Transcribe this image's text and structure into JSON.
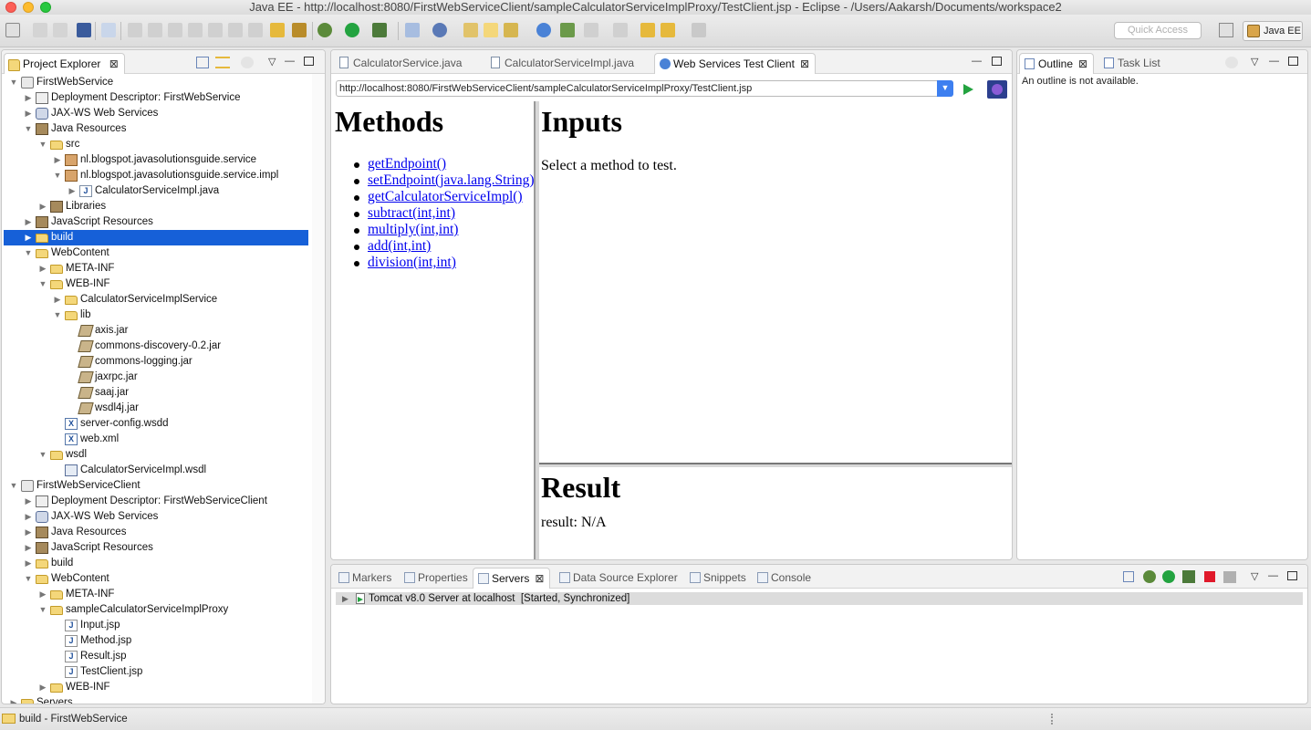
{
  "window": {
    "title": "Java EE - http://localhost:8080/FirstWebServiceClient/sampleCalculatorServiceImplProxy/TestClient.jsp - Eclipse - /Users/Aakarsh/Documents/workspace2"
  },
  "toolbar": {
    "quick_access_placeholder": "Quick Access",
    "perspective_label": "Java EE"
  },
  "project_explorer": {
    "tab_label": "Project Explorer",
    "close_glyph": "⊠",
    "items": [
      {
        "label": "FirstWebService",
        "depth": 0,
        "expanded": true,
        "icon": "project-icon"
      },
      {
        "label": "Deployment Descriptor: FirstWebService",
        "depth": 1,
        "expanded": false,
        "icon": "descriptor-icon"
      },
      {
        "label": "JAX-WS Web Services",
        "depth": 1,
        "expanded": false,
        "icon": "webservice-icon"
      },
      {
        "label": "Java Resources",
        "depth": 1,
        "expanded": true,
        "icon": "java-resources-icon"
      },
      {
        "label": "src",
        "depth": 2,
        "expanded": true,
        "icon": "source-folder-icon"
      },
      {
        "label": "nl.blogspot.javasolutionsguide.service",
        "depth": 3,
        "expanded": false,
        "icon": "package-icon"
      },
      {
        "label": "nl.blogspot.javasolutionsguide.service.impl",
        "depth": 3,
        "expanded": true,
        "icon": "package-icon"
      },
      {
        "label": "CalculatorServiceImpl.java",
        "depth": 4,
        "expanded": false,
        "icon": "java-file-icon"
      },
      {
        "label": "Libraries",
        "depth": 2,
        "expanded": false,
        "icon": "library-icon"
      },
      {
        "label": "JavaScript Resources",
        "depth": 1,
        "expanded": false,
        "icon": "javascript-resources-icon"
      },
      {
        "label": "build",
        "depth": 1,
        "expanded": false,
        "icon": "folder-icon",
        "selected": true
      },
      {
        "label": "WebContent",
        "depth": 1,
        "expanded": true,
        "icon": "folder-icon"
      },
      {
        "label": "META-INF",
        "depth": 2,
        "expanded": false,
        "icon": "folder-icon"
      },
      {
        "label": "WEB-INF",
        "depth": 2,
        "expanded": true,
        "icon": "folder-icon"
      },
      {
        "label": "CalculatorServiceImplService",
        "depth": 3,
        "expanded": false,
        "icon": "folder-icon"
      },
      {
        "label": "lib",
        "depth": 3,
        "expanded": true,
        "icon": "folder-icon"
      },
      {
        "label": "axis.jar",
        "depth": 4,
        "leaf": true,
        "icon": "jar-icon"
      },
      {
        "label": "commons-discovery-0.2.jar",
        "depth": 4,
        "leaf": true,
        "icon": "jar-icon"
      },
      {
        "label": "commons-logging.jar",
        "depth": 4,
        "leaf": true,
        "icon": "jar-icon"
      },
      {
        "label": "jaxrpc.jar",
        "depth": 4,
        "leaf": true,
        "icon": "jar-icon"
      },
      {
        "label": "saaj.jar",
        "depth": 4,
        "leaf": true,
        "icon": "jar-icon"
      },
      {
        "label": "wsdl4j.jar",
        "depth": 4,
        "leaf": true,
        "icon": "jar-icon"
      },
      {
        "label": "server-config.wsdd",
        "depth": 3,
        "leaf": true,
        "icon": "xml-file-icon"
      },
      {
        "label": "web.xml",
        "depth": 3,
        "leaf": true,
        "icon": "xml-file-icon"
      },
      {
        "label": "wsdl",
        "depth": 2,
        "expanded": true,
        "icon": "folder-icon"
      },
      {
        "label": "CalculatorServiceImpl.wsdl",
        "depth": 3,
        "leaf": true,
        "icon": "wsdl-file-icon"
      },
      {
        "label": "FirstWebServiceClient",
        "depth": 0,
        "expanded": true,
        "icon": "project-icon"
      },
      {
        "label": "Deployment Descriptor: FirstWebServiceClient",
        "depth": 1,
        "expanded": false,
        "icon": "descriptor-icon"
      },
      {
        "label": "JAX-WS Web Services",
        "depth": 1,
        "expanded": false,
        "icon": "webservice-icon"
      },
      {
        "label": "Java Resources",
        "depth": 1,
        "expanded": false,
        "icon": "java-resources-icon"
      },
      {
        "label": "JavaScript Resources",
        "depth": 1,
        "expanded": false,
        "icon": "javascript-resources-icon"
      },
      {
        "label": "build",
        "depth": 1,
        "expanded": false,
        "icon": "folder-icon"
      },
      {
        "label": "WebContent",
        "depth": 1,
        "expanded": true,
        "icon": "folder-icon"
      },
      {
        "label": "META-INF",
        "depth": 2,
        "expanded": false,
        "icon": "folder-icon"
      },
      {
        "label": "sampleCalculatorServiceImplProxy",
        "depth": 2,
        "expanded": true,
        "icon": "folder-icon"
      },
      {
        "label": "Input.jsp",
        "depth": 3,
        "leaf": true,
        "icon": "jsp-file-icon"
      },
      {
        "label": "Method.jsp",
        "depth": 3,
        "leaf": true,
        "icon": "jsp-file-icon"
      },
      {
        "label": "Result.jsp",
        "depth": 3,
        "leaf": true,
        "icon": "jsp-file-icon"
      },
      {
        "label": "TestClient.jsp",
        "depth": 3,
        "leaf": true,
        "icon": "jsp-file-icon"
      },
      {
        "label": "WEB-INF",
        "depth": 2,
        "expanded": false,
        "icon": "folder-icon"
      },
      {
        "label": "Servers",
        "depth": 0,
        "expanded": false,
        "icon": "folder-icon"
      }
    ]
  },
  "editor": {
    "tabs": [
      {
        "label": "CalculatorService.java",
        "active": false,
        "icon": "java-file-icon"
      },
      {
        "label": "CalculatorServiceImpl.java",
        "active": false,
        "icon": "java-file-icon"
      },
      {
        "label": "Web Services Test Client",
        "active": true,
        "icon": "globe-icon"
      }
    ],
    "url": "http://localhost:8080/FirstWebServiceClient/sampleCalculatorServiceImplProxy/TestClient.jsp",
    "methods_heading": "Methods",
    "methods": [
      "getEndpoint()",
      "setEndpoint(java.lang.String)",
      "getCalculatorServiceImpl()",
      "subtract(int,int)",
      "multiply(int,int)",
      "add(int,int)",
      "division(int,int)"
    ],
    "inputs_heading": "Inputs",
    "inputs_text": "Select a method to test.",
    "result_heading": "Result",
    "result_text": "result: N/A"
  },
  "outline": {
    "tabs": [
      {
        "label": "Outline",
        "active": true
      },
      {
        "label": "Task List",
        "active": false
      }
    ],
    "message": "An outline is not available."
  },
  "bottom": {
    "tabs": [
      {
        "label": "Markers",
        "active": false,
        "icon": "markers-icon"
      },
      {
        "label": "Properties",
        "active": false,
        "icon": "properties-icon"
      },
      {
        "label": "Servers",
        "active": true,
        "icon": "servers-icon"
      },
      {
        "label": "Data Source Explorer",
        "active": false,
        "icon": "data-source-icon"
      },
      {
        "label": "Snippets",
        "active": false,
        "icon": "snippets-icon"
      },
      {
        "label": "Console",
        "active": false,
        "icon": "console-icon"
      }
    ],
    "server_row": "Tomcat v8.0 Server at localhost  [Started, Synchronized]"
  },
  "statusbar": {
    "text": "build - FirstWebService"
  },
  "colors": {
    "selection": "#1660d8",
    "link": "#0000ee",
    "run_green": "#23a340"
  }
}
